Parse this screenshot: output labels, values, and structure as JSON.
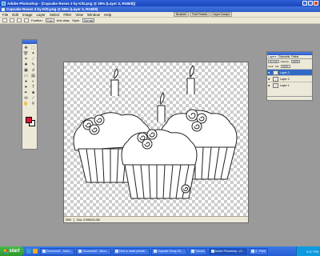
{
  "app": {
    "title": "Adobe Photoshop - [Cupcake Roses 3 by K/D.png @ 25% (Layer 3, RGB/8)]"
  },
  "document": {
    "title_text": "Cupcake Roses 3 by K/D.png @ 25% (Layer 3, RGB/8)",
    "zoom": "25%",
    "status_info": "Doc: 4.09M/24.0M"
  },
  "menu": [
    "File",
    "Edit",
    "Image",
    "Layer",
    "Select",
    "Filter",
    "View",
    "Window",
    "Help"
  ],
  "palette_well": [
    "Brushes",
    "Tool Presets",
    "Layer Comps"
  ],
  "options_bar": {
    "feather_label": "Feather:",
    "feather_value": "0 px",
    "antialias_label": "Anti-alias",
    "style_label": "Style:",
    "style_value": "Normal"
  },
  "toolbox": {
    "tools": [
      "move-icon",
      "marquee-icon",
      "lasso-icon",
      "magic-wand-icon",
      "crop-icon",
      "slice-icon",
      "healing-icon",
      "brush-icon",
      "stamp-icon",
      "history-brush-icon",
      "eraser-icon",
      "gradient-icon",
      "blur-icon",
      "dodge-icon",
      "path-select-icon",
      "type-icon",
      "pen-icon",
      "shape-icon",
      "notes-icon",
      "eyedropper-icon",
      "hand-icon",
      "zoom-icon"
    ],
    "foreground_color": "#e0103a",
    "background_color": "#ffffff"
  },
  "layers_panel": {
    "tabs": [
      "Layers",
      "Channels",
      "Paths"
    ],
    "blend_mode": "Normal",
    "opacity_label": "Opacity:",
    "opacity_value": "100%",
    "lock_label": "Lock:",
    "fill_label": "Fill:",
    "fill_value": "100%",
    "layers": [
      {
        "name": "Layer 3",
        "selected": true
      },
      {
        "name": "Layer 2",
        "selected": false
      },
      {
        "name": "Layer 1",
        "selected": false
      }
    ]
  },
  "taskbar": {
    "start_label": "start",
    "tasks": [
      "Document1 - Micro...",
      "Document2 - Micro...",
      "How to make printab...",
      "Cupcake Scrap Kit -...",
      "Tutorial",
      "Adobe Photoshop - [C...",
      "3 - Paint"
    ],
    "active_task_index": 5,
    "clock": "9:17 PM"
  },
  "colors": {
    "titlebar": "#245ed6",
    "workspace": "#9a9a9a",
    "ui_face": "#ece9d8",
    "selection": "#316ac5"
  }
}
